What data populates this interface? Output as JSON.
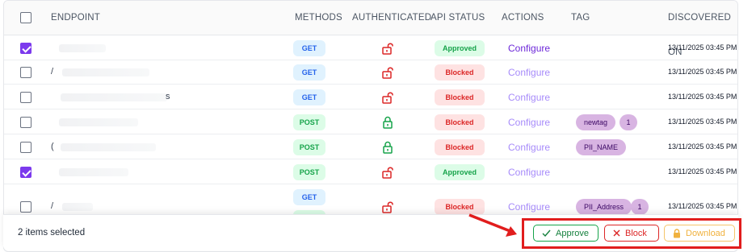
{
  "table": {
    "headers": {
      "endpoint": "ENDPOINT",
      "methods": "METHODS",
      "authenticated": "AUTHENTICATED",
      "api_status": "API STATUS",
      "actions": "ACTIONS",
      "tag": "TAG",
      "discovered_on": "DISCOVERED ON"
    },
    "rows": [
      {
        "checked": true,
        "endpoint_mark": "",
        "methods": [
          "GET"
        ],
        "authenticated": "unlocked",
        "status": "Approved",
        "action": "Configure",
        "tags": [],
        "tag_count": "",
        "discovered_on": "13/11/2025 03:45 PM"
      },
      {
        "checked": false,
        "endpoint_mark": "/",
        "methods": [
          "GET"
        ],
        "authenticated": "unlocked",
        "status": "Blocked",
        "action": "Configure",
        "tags": [],
        "tag_count": "",
        "discovered_on": "13/11/2025 03:45 PM"
      },
      {
        "checked": false,
        "endpoint_mark": "s",
        "methods": [
          "GET"
        ],
        "authenticated": "unlocked",
        "status": "Blocked",
        "action": "Configure",
        "tags": [],
        "tag_count": "",
        "discovered_on": "13/11/2025 03:45 PM"
      },
      {
        "checked": false,
        "endpoint_mark": "",
        "methods": [
          "POST"
        ],
        "authenticated": "locked",
        "status": "Blocked",
        "action": "Configure",
        "tags": [
          "newtag"
        ],
        "tag_count": "1",
        "discovered_on": "13/11/2025 03:45 PM"
      },
      {
        "checked": false,
        "endpoint_mark": "(",
        "methods": [
          "POST"
        ],
        "authenticated": "locked",
        "status": "Blocked",
        "action": "Configure",
        "tags": [
          "PII_NAME"
        ],
        "tag_count": "",
        "discovered_on": "13/11/2025 03:45 PM"
      },
      {
        "checked": true,
        "endpoint_mark": "",
        "methods": [
          "POST"
        ],
        "authenticated": "unlocked",
        "status": "Approved",
        "action": "Configure",
        "tags": [],
        "tag_count": "",
        "discovered_on": "13/11/2025 03:45 PM"
      },
      {
        "checked": false,
        "endpoint_mark": "/",
        "methods": [
          "GET",
          "POST"
        ],
        "authenticated": "unlocked",
        "status": "Blocked",
        "action": "Configure",
        "tags": [
          "PII_Address"
        ],
        "tag_count": "1",
        "discovered_on": "13/11/2025 03:45 PM"
      }
    ]
  },
  "footer": {
    "selected_text": "2 items selected",
    "approve_label": "Approve",
    "block_label": "Block",
    "download_label": "Download"
  },
  "icons": {
    "approve": "check-icon",
    "block": "x-icon",
    "download": "lock-icon",
    "authenticated_locked": "lock-closed-icon",
    "authenticated_unlocked": "lock-open-icon"
  },
  "colors": {
    "accent": "#7c3aed",
    "approved": "#16a34a",
    "blocked": "#dc2626",
    "download": "#f0b13e",
    "highlight": "#e11d1d"
  }
}
